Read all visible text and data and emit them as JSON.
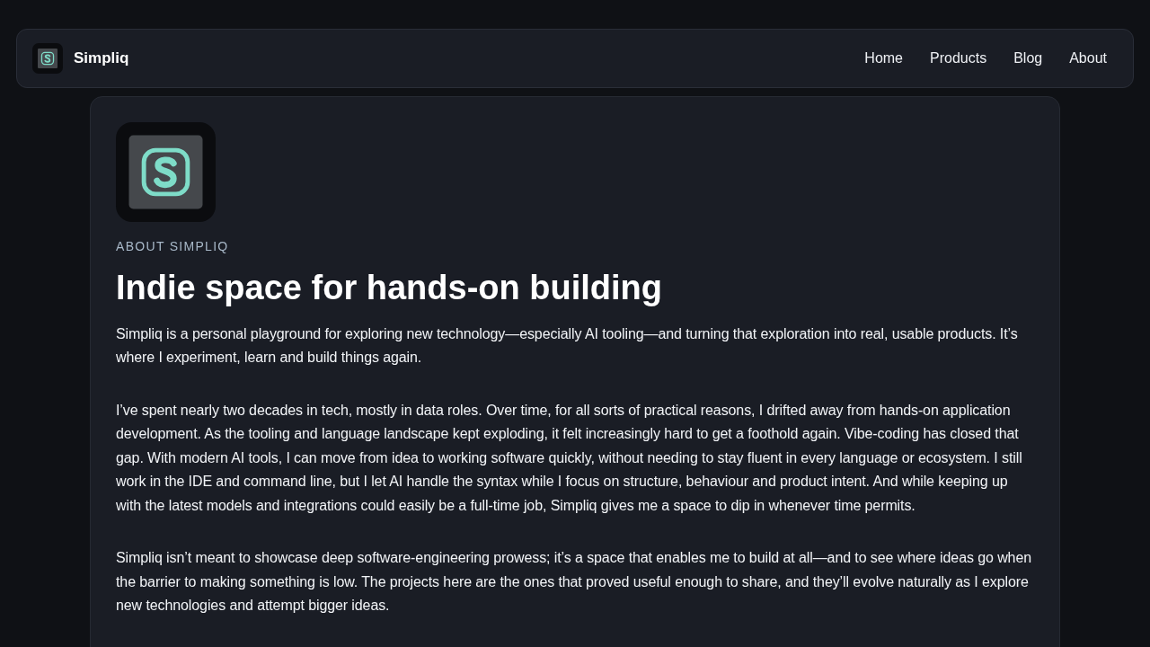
{
  "brand": {
    "name": "Simpliq"
  },
  "nav": [
    {
      "label": "Home"
    },
    {
      "label": "Products"
    },
    {
      "label": "Blog"
    },
    {
      "label": "About"
    }
  ],
  "about": {
    "eyebrow": "ABOUT SIMPLIQ",
    "title": "Indie space for hands-on building",
    "paragraphs": [
      "Simpliq is a personal playground for exploring new technology—especially AI tooling—and turning that exploration into real, usable products. It’s where I experiment, learn and build things again.",
      "I’ve spent nearly two decades in tech, mostly in data roles. Over time, for all sorts of practical reasons, I drifted away from hands-on application development. As the tooling and language landscape kept exploding, it felt increasingly hard to get a foothold again. Vibe-coding has closed that gap. With modern AI tools, I can move from idea to working software quickly, without needing to stay fluent in every language or ecosystem. I still work in the IDE and command line, but I let AI handle the syntax while I focus on structure, behaviour and product intent. And while keeping up with the latest models and integrations could easily be a full-time job, Simpliq gives me a space to dip in whenever time permits.",
      "Simpliq isn’t meant to showcase deep software-engineering prowess; it’s a space that enables me to build at all—and to see where ideas go when the barrier to making something is low. The projects here are the ones that proved useful enough to share, and they’ll evolve naturally as I explore new technologies and attempt bigger ideas."
    ]
  }
}
